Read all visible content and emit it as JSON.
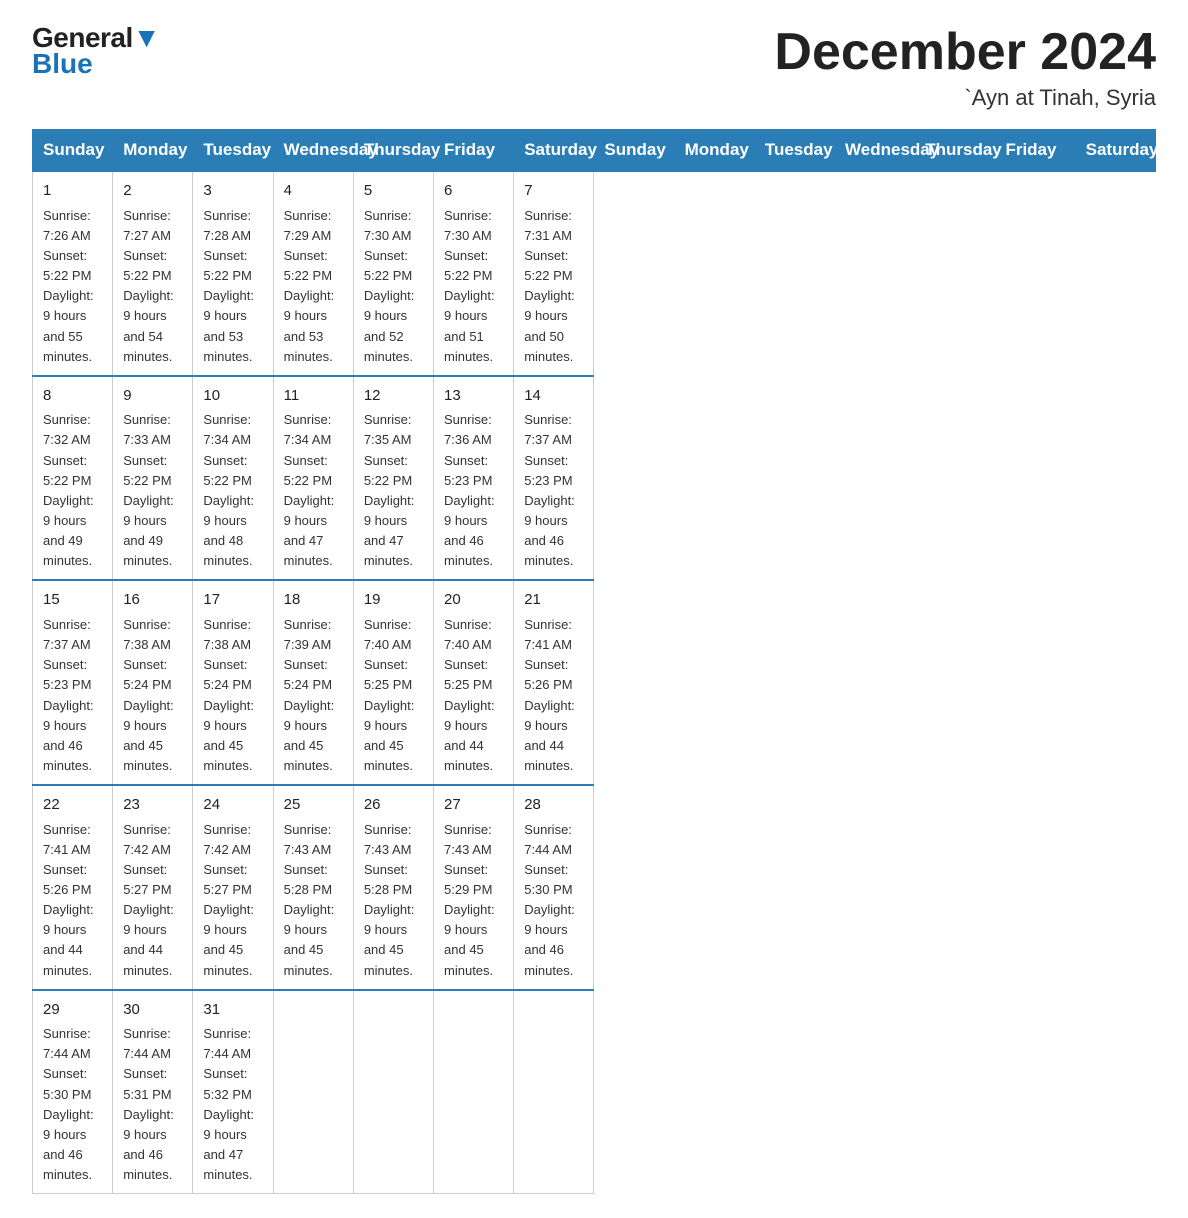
{
  "header": {
    "logo_general": "General",
    "logo_blue": "Blue",
    "month": "December 2024",
    "location": "`Ayn at Tinah, Syria"
  },
  "days_of_week": [
    "Sunday",
    "Monday",
    "Tuesday",
    "Wednesday",
    "Thursday",
    "Friday",
    "Saturday"
  ],
  "weeks": [
    [
      {
        "num": "1",
        "sunrise": "7:26 AM",
        "sunset": "5:22 PM",
        "daylight": "9 hours and 55 minutes."
      },
      {
        "num": "2",
        "sunrise": "7:27 AM",
        "sunset": "5:22 PM",
        "daylight": "9 hours and 54 minutes."
      },
      {
        "num": "3",
        "sunrise": "7:28 AM",
        "sunset": "5:22 PM",
        "daylight": "9 hours and 53 minutes."
      },
      {
        "num": "4",
        "sunrise": "7:29 AM",
        "sunset": "5:22 PM",
        "daylight": "9 hours and 53 minutes."
      },
      {
        "num": "5",
        "sunrise": "7:30 AM",
        "sunset": "5:22 PM",
        "daylight": "9 hours and 52 minutes."
      },
      {
        "num": "6",
        "sunrise": "7:30 AM",
        "sunset": "5:22 PM",
        "daylight": "9 hours and 51 minutes."
      },
      {
        "num": "7",
        "sunrise": "7:31 AM",
        "sunset": "5:22 PM",
        "daylight": "9 hours and 50 minutes."
      }
    ],
    [
      {
        "num": "8",
        "sunrise": "7:32 AM",
        "sunset": "5:22 PM",
        "daylight": "9 hours and 49 minutes."
      },
      {
        "num": "9",
        "sunrise": "7:33 AM",
        "sunset": "5:22 PM",
        "daylight": "9 hours and 49 minutes."
      },
      {
        "num": "10",
        "sunrise": "7:34 AM",
        "sunset": "5:22 PM",
        "daylight": "9 hours and 48 minutes."
      },
      {
        "num": "11",
        "sunrise": "7:34 AM",
        "sunset": "5:22 PM",
        "daylight": "9 hours and 47 minutes."
      },
      {
        "num": "12",
        "sunrise": "7:35 AM",
        "sunset": "5:22 PM",
        "daylight": "9 hours and 47 minutes."
      },
      {
        "num": "13",
        "sunrise": "7:36 AM",
        "sunset": "5:23 PM",
        "daylight": "9 hours and 46 minutes."
      },
      {
        "num": "14",
        "sunrise": "7:37 AM",
        "sunset": "5:23 PM",
        "daylight": "9 hours and 46 minutes."
      }
    ],
    [
      {
        "num": "15",
        "sunrise": "7:37 AM",
        "sunset": "5:23 PM",
        "daylight": "9 hours and 46 minutes."
      },
      {
        "num": "16",
        "sunrise": "7:38 AM",
        "sunset": "5:24 PM",
        "daylight": "9 hours and 45 minutes."
      },
      {
        "num": "17",
        "sunrise": "7:38 AM",
        "sunset": "5:24 PM",
        "daylight": "9 hours and 45 minutes."
      },
      {
        "num": "18",
        "sunrise": "7:39 AM",
        "sunset": "5:24 PM",
        "daylight": "9 hours and 45 minutes."
      },
      {
        "num": "19",
        "sunrise": "7:40 AM",
        "sunset": "5:25 PM",
        "daylight": "9 hours and 45 minutes."
      },
      {
        "num": "20",
        "sunrise": "7:40 AM",
        "sunset": "5:25 PM",
        "daylight": "9 hours and 44 minutes."
      },
      {
        "num": "21",
        "sunrise": "7:41 AM",
        "sunset": "5:26 PM",
        "daylight": "9 hours and 44 minutes."
      }
    ],
    [
      {
        "num": "22",
        "sunrise": "7:41 AM",
        "sunset": "5:26 PM",
        "daylight": "9 hours and 44 minutes."
      },
      {
        "num": "23",
        "sunrise": "7:42 AM",
        "sunset": "5:27 PM",
        "daylight": "9 hours and 44 minutes."
      },
      {
        "num": "24",
        "sunrise": "7:42 AM",
        "sunset": "5:27 PM",
        "daylight": "9 hours and 45 minutes."
      },
      {
        "num": "25",
        "sunrise": "7:43 AM",
        "sunset": "5:28 PM",
        "daylight": "9 hours and 45 minutes."
      },
      {
        "num": "26",
        "sunrise": "7:43 AM",
        "sunset": "5:28 PM",
        "daylight": "9 hours and 45 minutes."
      },
      {
        "num": "27",
        "sunrise": "7:43 AM",
        "sunset": "5:29 PM",
        "daylight": "9 hours and 45 minutes."
      },
      {
        "num": "28",
        "sunrise": "7:44 AM",
        "sunset": "5:30 PM",
        "daylight": "9 hours and 46 minutes."
      }
    ],
    [
      {
        "num": "29",
        "sunrise": "7:44 AM",
        "sunset": "5:30 PM",
        "daylight": "9 hours and 46 minutes."
      },
      {
        "num": "30",
        "sunrise": "7:44 AM",
        "sunset": "5:31 PM",
        "daylight": "9 hours and 46 minutes."
      },
      {
        "num": "31",
        "sunrise": "7:44 AM",
        "sunset": "5:32 PM",
        "daylight": "9 hours and 47 minutes."
      },
      null,
      null,
      null,
      null
    ]
  ]
}
